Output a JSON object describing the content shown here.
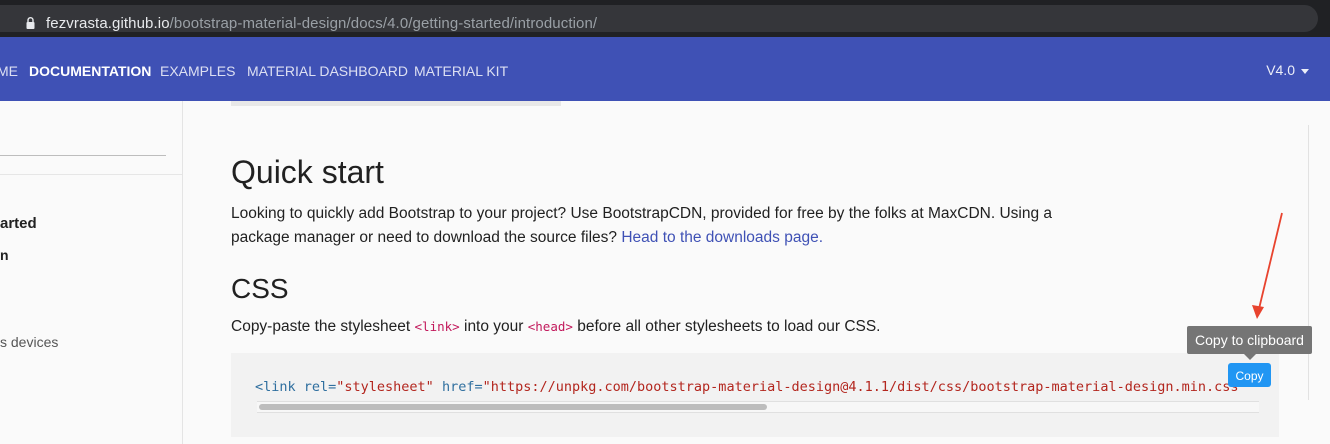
{
  "browser": {
    "url_host": "fezvrasta.github.io",
    "url_path": "/bootstrap-material-design/docs/4.0/getting-started/introduction/",
    "lock_icon": "lock-icon"
  },
  "navbar": {
    "items": [
      {
        "label": "ME",
        "active": false
      },
      {
        "label": "DOCUMENTATION",
        "active": true
      },
      {
        "label": "EXAMPLES",
        "active": false
      },
      {
        "label": "MATERIAL DASHBOARD",
        "active": false
      },
      {
        "label": "MATERIAL KIT",
        "active": false
      }
    ],
    "version": "V4.0",
    "color": "#3f51b5"
  },
  "sidebar": {
    "items": [
      {
        "label": "arted"
      },
      {
        "label": "n"
      },
      {
        "label": "s devices"
      }
    ]
  },
  "main": {
    "quick_start_title": "Quick start",
    "quick_start_text": "Looking to quickly add Bootstrap to your project? Use BootstrapCDN, provided for free by the folks at MaxCDN. Using a package manager or need to download the source files? ",
    "quick_start_link": "Head to the downloads page.",
    "css_title": "CSS",
    "css_text_1": "Copy-paste the stylesheet ",
    "css_code_1": "<link>",
    "css_text_2": " into your ",
    "css_code_2": "<head>",
    "css_text_3": " before all other stylesheets to load our CSS.",
    "code": {
      "tag_open": "<link",
      "attr1": " rel=",
      "val1": "\"stylesheet\"",
      "attr2": " href=",
      "val2": "\"https://unpkg.com/bootstrap-material-design@4.1.1/dist/css/bootstrap-material-design.min.css\""
    },
    "copy_button": "Copy",
    "tooltip": "Copy to clipboard",
    "link_color": "#3f51b5",
    "code_string_color": "#b3261e",
    "copy_button_color": "#2196f3",
    "annotation_arrow_color": "#e8432e"
  }
}
